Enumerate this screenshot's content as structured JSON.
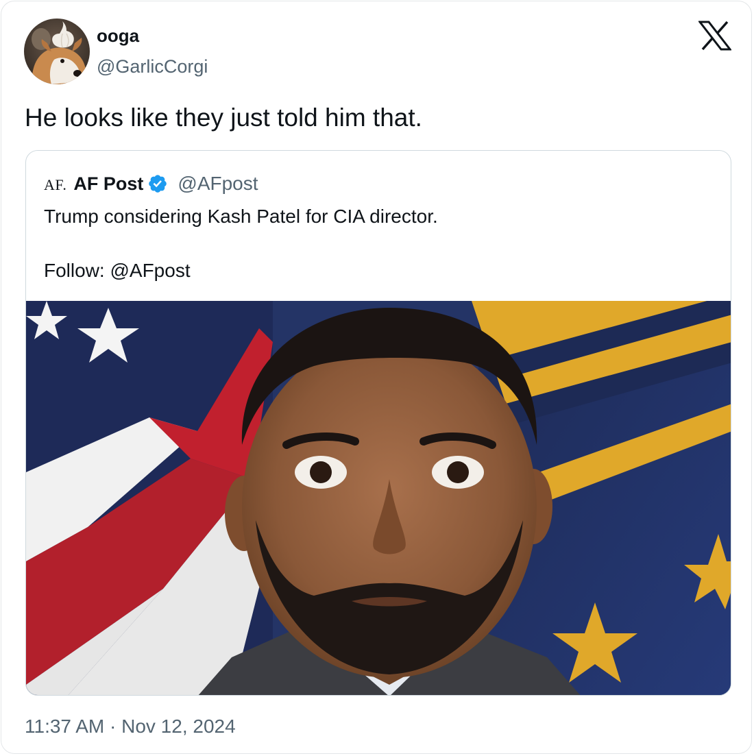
{
  "author": {
    "display_name": "ooga",
    "handle": "@GarlicCorgi",
    "avatar_icon": "corgi-avatar"
  },
  "platform_icon": "x-logo-icon",
  "tweet": {
    "text": "He looks like they just told him that.",
    "timestamp": "11:37 AM · Nov 12, 2024"
  },
  "quoted_tweet": {
    "logo_text": "AF.",
    "display_name": "AF Post",
    "verified": true,
    "verified_color": "#1d9bf0",
    "handle": "@AFpost",
    "lines": [
      "Trump considering Kash Patel for CIA director.",
      "Follow: @AFpost"
    ],
    "image_icon": "portrait-photo"
  },
  "colors": {
    "text_primary": "#0f1419",
    "text_secondary": "#536471",
    "border": "#cfd9de"
  }
}
